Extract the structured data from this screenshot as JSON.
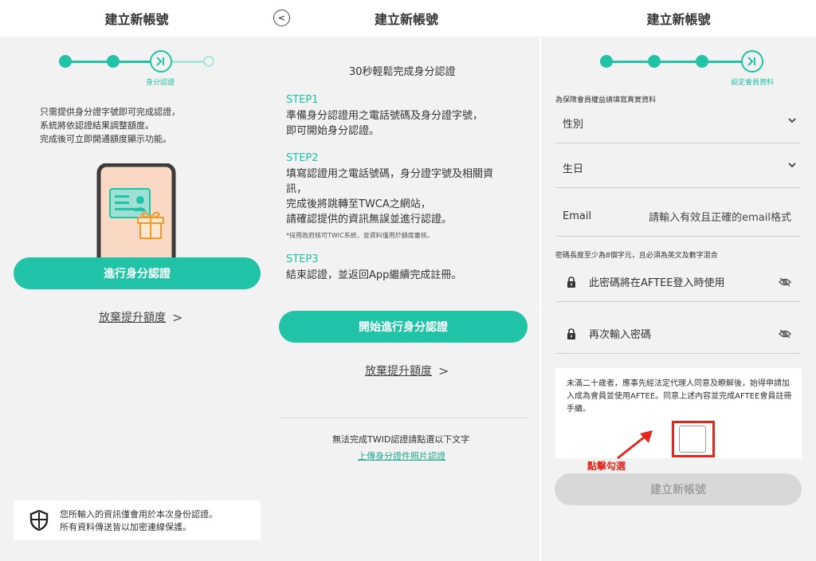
{
  "panel1": {
    "title": "建立新帳號",
    "step_caption": "身分認證",
    "intro_lines": [
      "只需提供身分證字號即可完成認證，",
      "系統將依認證結果調整額度。",
      "完成後可立即開通額度顯示功能。"
    ],
    "verify_button": "進行身分認證",
    "skip_link": "放棄提升額度",
    "skip_chevron": ">",
    "notice_lines": [
      "您所輸入的資訊僅會用於本次身份認證。",
      "所有資料傳送皆以加密連線保護。"
    ]
  },
  "panel2": {
    "title": "建立新帳號",
    "back_glyph": "<",
    "subtitle": "30秒輕鬆完成身分認證",
    "steps": [
      {
        "title": "STEP1",
        "lines": [
          "準備身分認證用之電話號碼及身分證字號，",
          "即可開始身分認證。"
        ]
      },
      {
        "title": "STEP2",
        "lines": [
          "填寫認證用之電話號碼，身分證字號及相關資",
          "訊，",
          "完成後將跳轉至TWCA之網站，",
          "請確認提供的資訊無誤並進行認證。"
        ]
      },
      {
        "title": "STEP3",
        "lines": [
          "結束認證，並返回App繼續完成註冊。"
        ]
      }
    ],
    "step2_note": "*採用政府核可TWIC系統，並資料僅用於額度審核。",
    "start_button": "開始進行身分認證",
    "skip_link": "放棄提升額度",
    "skip_chevron": ">",
    "fallback_text": "無法完成TWID認證請點選以下文字",
    "upload_link": "上傳身分證件照片認證"
  },
  "panel3": {
    "title": "建立新帳號",
    "step_caption": "設定會員資料",
    "info_note": "為保障會員權益請填寫真實資料",
    "gender_label": "性別",
    "birthday_label": "生日",
    "email_label": "Email",
    "email_placeholder": "請輸入有效且正確的email格式",
    "password_rule": "密碼長度至少為8個字元，且必須為英文及數字混合",
    "password_placeholder": "此密碼將在AFTEE登入時使用",
    "password_confirm_placeholder": "再次輸入密碼",
    "agreement_text": "未滿二十歲者，應事先經法定代理人同意及瞭解後，始得申請加入成為會員並使用AFTEE。同意上述內容並完成AFTEE會員註冊手續。",
    "annotation": "點擊勾選",
    "create_button": "建立新帳號"
  },
  "colors": {
    "accent": "#20c3a6",
    "accent_light": "#a8e6da",
    "annotation_red": "#e5261c",
    "disabled": "#d8d8d8"
  }
}
